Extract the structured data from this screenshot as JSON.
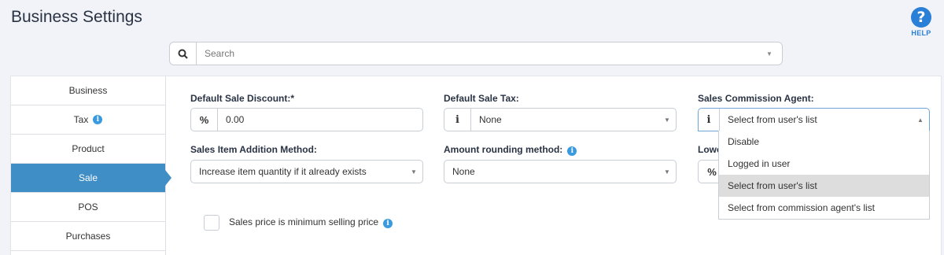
{
  "page": {
    "title": "Business Settings"
  },
  "help": {
    "label": "HELP",
    "icon": "question-circle-icon"
  },
  "search": {
    "placeholder": "Search"
  },
  "sidebar": {
    "items": [
      {
        "label": "Business"
      },
      {
        "label": "Tax",
        "info": "i"
      },
      {
        "label": "Product"
      },
      {
        "label": "Sale",
        "active": true
      },
      {
        "label": "POS"
      },
      {
        "label": "Purchases"
      }
    ]
  },
  "sale": {
    "discount_label": "Default Sale Discount:*",
    "discount_addon": "%",
    "discount_value": "0.00",
    "tax_label": "Default Sale Tax:",
    "tax_addon": "i",
    "tax_value": "None",
    "agent_label": "Sales Commission Agent:",
    "agent_addon": "i",
    "agent_value": "Select from user's list",
    "addition_label": "Sales Item Addition Method:",
    "addition_value": "Increase item quantity if it already exists",
    "rounding_label": "Amount rounding method:",
    "rounding_info": "i",
    "rounding_value": "None",
    "lowest_label_partial": "Lowe",
    "lowest_addon": "%",
    "min_price_label": "Sales price is minimum selling price",
    "min_price_info": "i"
  },
  "agent_dropdown": {
    "options": [
      "Disable",
      "Logged in user",
      "Select from user's list",
      "Select from commission agent's list"
    ],
    "selected_index": 2
  },
  "colors": {
    "accent": "#3f8ec6",
    "help": "#2a7fd6",
    "info": "#3a9ae0"
  }
}
